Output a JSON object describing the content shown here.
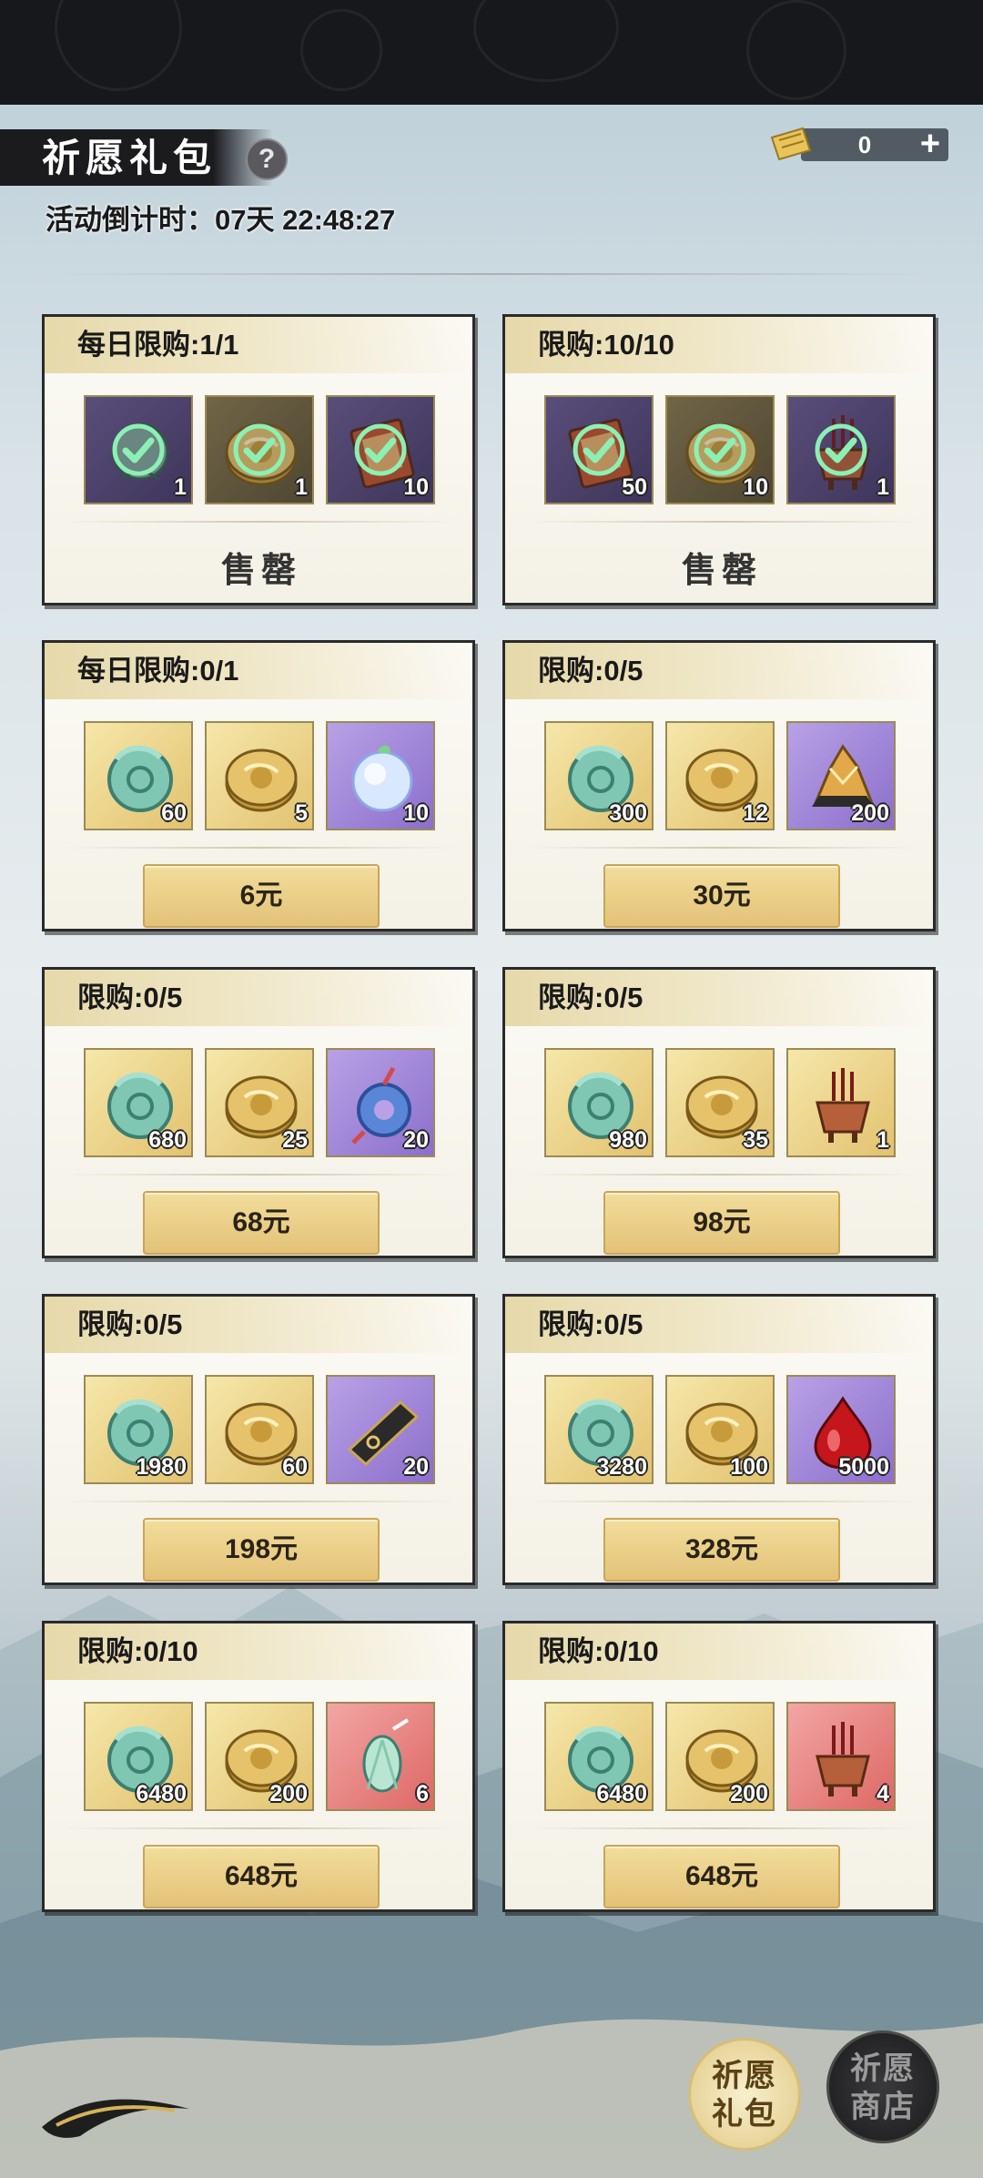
{
  "header": {
    "title": "祈愿礼包",
    "help_label": "?",
    "countdown": "活动倒计时：07天 22:48:27"
  },
  "currency": {
    "icon": "ticket-icon",
    "value": "0",
    "plus_label": "+"
  },
  "packages": [
    {
      "limit": "每日限购:1/1",
      "sold_out": true,
      "action_label": "售罄",
      "items": [
        {
          "icon": "jade-pendant-icon",
          "bg": "dark-purple",
          "qty": "1",
          "claimed": true
        },
        {
          "icon": "gold-coin-icon",
          "bg": "dark-gold",
          "qty": "1",
          "claimed": true
        },
        {
          "icon": "scroll-ticket-icon",
          "bg": "dark-purple",
          "qty": "10",
          "claimed": true
        }
      ]
    },
    {
      "limit": "限购:10/10",
      "sold_out": true,
      "action_label": "售罄",
      "items": [
        {
          "icon": "scroll-ticket-icon",
          "bg": "dark-purple",
          "qty": "50",
          "claimed": true
        },
        {
          "icon": "gold-coin-icon",
          "bg": "dark-gold",
          "qty": "10",
          "claimed": true
        },
        {
          "icon": "incense-burner-icon",
          "bg": "dark-purple",
          "qty": "1",
          "claimed": true
        }
      ]
    },
    {
      "limit": "每日限购:0/1",
      "sold_out": false,
      "action_label": "6元",
      "items": [
        {
          "icon": "jade-dragon-icon",
          "bg": "gold",
          "qty": "60"
        },
        {
          "icon": "gold-coin-icon",
          "bg": "gold",
          "qty": "5"
        },
        {
          "icon": "peach-orb-icon",
          "bg": "purple",
          "qty": "10"
        }
      ]
    },
    {
      "limit": "限购:0/5",
      "sold_out": false,
      "action_label": "30元",
      "items": [
        {
          "icon": "jade-dragon-icon",
          "bg": "gold",
          "qty": "300"
        },
        {
          "icon": "gold-coin-icon",
          "bg": "gold",
          "qty": "12"
        },
        {
          "icon": "crystal-ore-icon",
          "bg": "purple",
          "qty": "200"
        }
      ]
    },
    {
      "limit": "限购:0/5",
      "sold_out": false,
      "action_label": "68元",
      "items": [
        {
          "icon": "jade-dragon-icon",
          "bg": "gold",
          "qty": "680"
        },
        {
          "icon": "gold-coin-icon",
          "bg": "gold",
          "qty": "25"
        },
        {
          "icon": "bead-pendant-icon",
          "bg": "purple",
          "qty": "20"
        }
      ]
    },
    {
      "limit": "限购:0/5",
      "sold_out": false,
      "action_label": "98元",
      "items": [
        {
          "icon": "jade-dragon-icon",
          "bg": "gold",
          "qty": "980"
        },
        {
          "icon": "gold-coin-icon",
          "bg": "gold",
          "qty": "35"
        },
        {
          "icon": "incense-burner-icon",
          "bg": "gold",
          "qty": "1"
        }
      ]
    },
    {
      "limit": "限购:0/5",
      "sold_out": false,
      "action_label": "198元",
      "items": [
        {
          "icon": "jade-dragon-icon",
          "bg": "gold",
          "qty": "1980"
        },
        {
          "icon": "gold-coin-icon",
          "bg": "gold",
          "qty": "60"
        },
        {
          "icon": "black-token-icon",
          "bg": "purple",
          "qty": "20"
        }
      ]
    },
    {
      "limit": "限购:0/5",
      "sold_out": false,
      "action_label": "328元",
      "items": [
        {
          "icon": "jade-dragon-icon",
          "bg": "gold",
          "qty": "3280"
        },
        {
          "icon": "gold-coin-icon",
          "bg": "gold",
          "qty": "100"
        },
        {
          "icon": "blood-drop-icon",
          "bg": "purple",
          "qty": "5000"
        }
      ]
    },
    {
      "limit": "限购:0/10",
      "sold_out": false,
      "action_label": "648元",
      "items": [
        {
          "icon": "jade-dragon-icon",
          "bg": "gold",
          "qty": "6480"
        },
        {
          "icon": "gold-coin-icon",
          "bg": "gold",
          "qty": "200"
        },
        {
          "icon": "jade-cicada-icon",
          "bg": "red",
          "qty": "6"
        }
      ]
    },
    {
      "limit": "限购:0/10",
      "sold_out": false,
      "action_label": "648元",
      "items": [
        {
          "icon": "jade-dragon-icon",
          "bg": "gold",
          "qty": "6480"
        },
        {
          "icon": "gold-coin-icon",
          "bg": "gold",
          "qty": "200"
        },
        {
          "icon": "incense-burner-icon",
          "bg": "red",
          "qty": "4"
        }
      ]
    }
  ],
  "bottom_tabs": {
    "active": {
      "line1": "祈愿",
      "line2": "礼包"
    },
    "inactive": {
      "line1": "祈愿",
      "line2": "商店"
    }
  },
  "colors": {
    "gold_button": "#e3c278",
    "card_bg": "#f4f1e6",
    "purple_tile": "#8b6fcb",
    "red_tile": "#dd6865"
  }
}
